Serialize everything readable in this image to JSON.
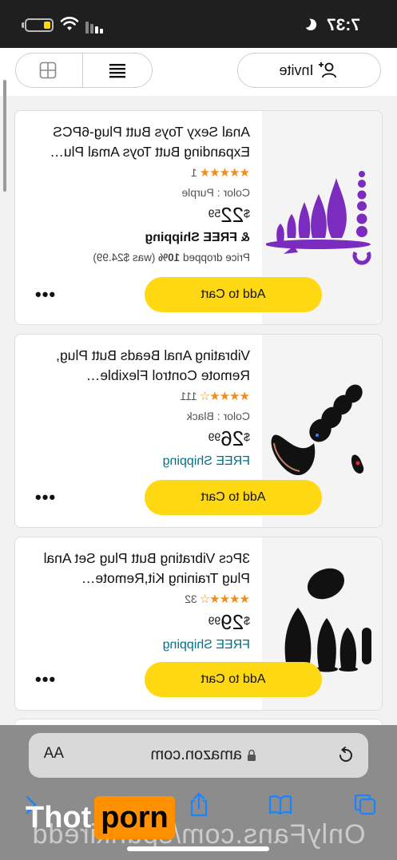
{
  "status_bar": {
    "time": "7:37"
  },
  "toolbar": {
    "invite_label": "Invite"
  },
  "products": [
    {
      "title": "Anal Sexy Toys Butt Plug-6PCS Expanding Butt Toys Amal Plu…",
      "rating_count": "1",
      "variant": "Color : Purple",
      "price_currency": "$",
      "price_whole": "22",
      "price_fraction": "59",
      "shipping": "FREE Shipping",
      "price_drop_prefix": "Price dropped",
      "price_drop_percent": "10%",
      "price_drop_was": "(was $24.99)",
      "add_to_cart": "Add to Cart",
      "more": "•••"
    },
    {
      "title": "Vibrating Anal Beads Butt Plug, Remote Control Flexible…",
      "rating_count": "111",
      "variant": "Color : Black",
      "price_currency": "$",
      "price_whole": "26",
      "price_fraction": "99",
      "shipping": "FREE Shipping",
      "add_to_cart": "Add to Cart",
      "more": "•••"
    },
    {
      "title": "3Pcs Vibrating Butt Plug Set Anal Plug Training Kit,Remote…",
      "rating_count": "32",
      "price_currency": "$",
      "price_whole": "29",
      "price_fraction": "99",
      "shipping": "FREE Shipping",
      "add_to_cart": "Add to Cart",
      "more": "•••"
    }
  ],
  "browser": {
    "domain": "amazon.com",
    "text_size_label": "AA"
  },
  "watermark": {
    "logo_left": "Thot",
    "logo_right": "porn",
    "url": "OnlyFans.com/spunkiredd"
  },
  "colors": {
    "accent_button": "#ffd814",
    "star": "#ef8c1a",
    "free_shipping_teal": "#007185",
    "ios_blue": "#1a84ff"
  }
}
